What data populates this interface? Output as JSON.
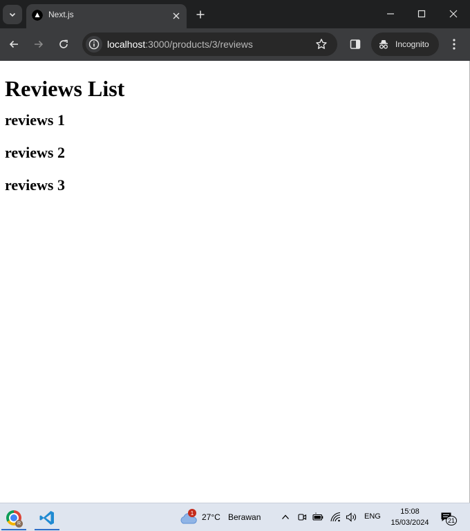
{
  "browser": {
    "tab": {
      "title": "Next.js"
    },
    "address_bar": {
      "url_host": "localhost",
      "url_path": ":3000/products/3/reviews"
    },
    "incognito_label": "Incognito"
  },
  "page": {
    "heading": "Reviews List",
    "reviews": [
      "reviews 1",
      "reviews 2",
      "reviews 3"
    ]
  },
  "taskbar": {
    "weather": {
      "badge": "1",
      "temperature": "27°C",
      "condition": "Berawan"
    },
    "language": "ENG",
    "clock": {
      "time": "15:08",
      "date": "15/03/2024"
    },
    "notifications": "21",
    "chrome_profile_initial": "R"
  },
  "colors": {
    "titlebar": "#1f2021",
    "toolbar": "#3b3c3e",
    "omnibox": "#282828",
    "taskbar": "#dfe5ef",
    "accent": "#2f6ec7"
  }
}
